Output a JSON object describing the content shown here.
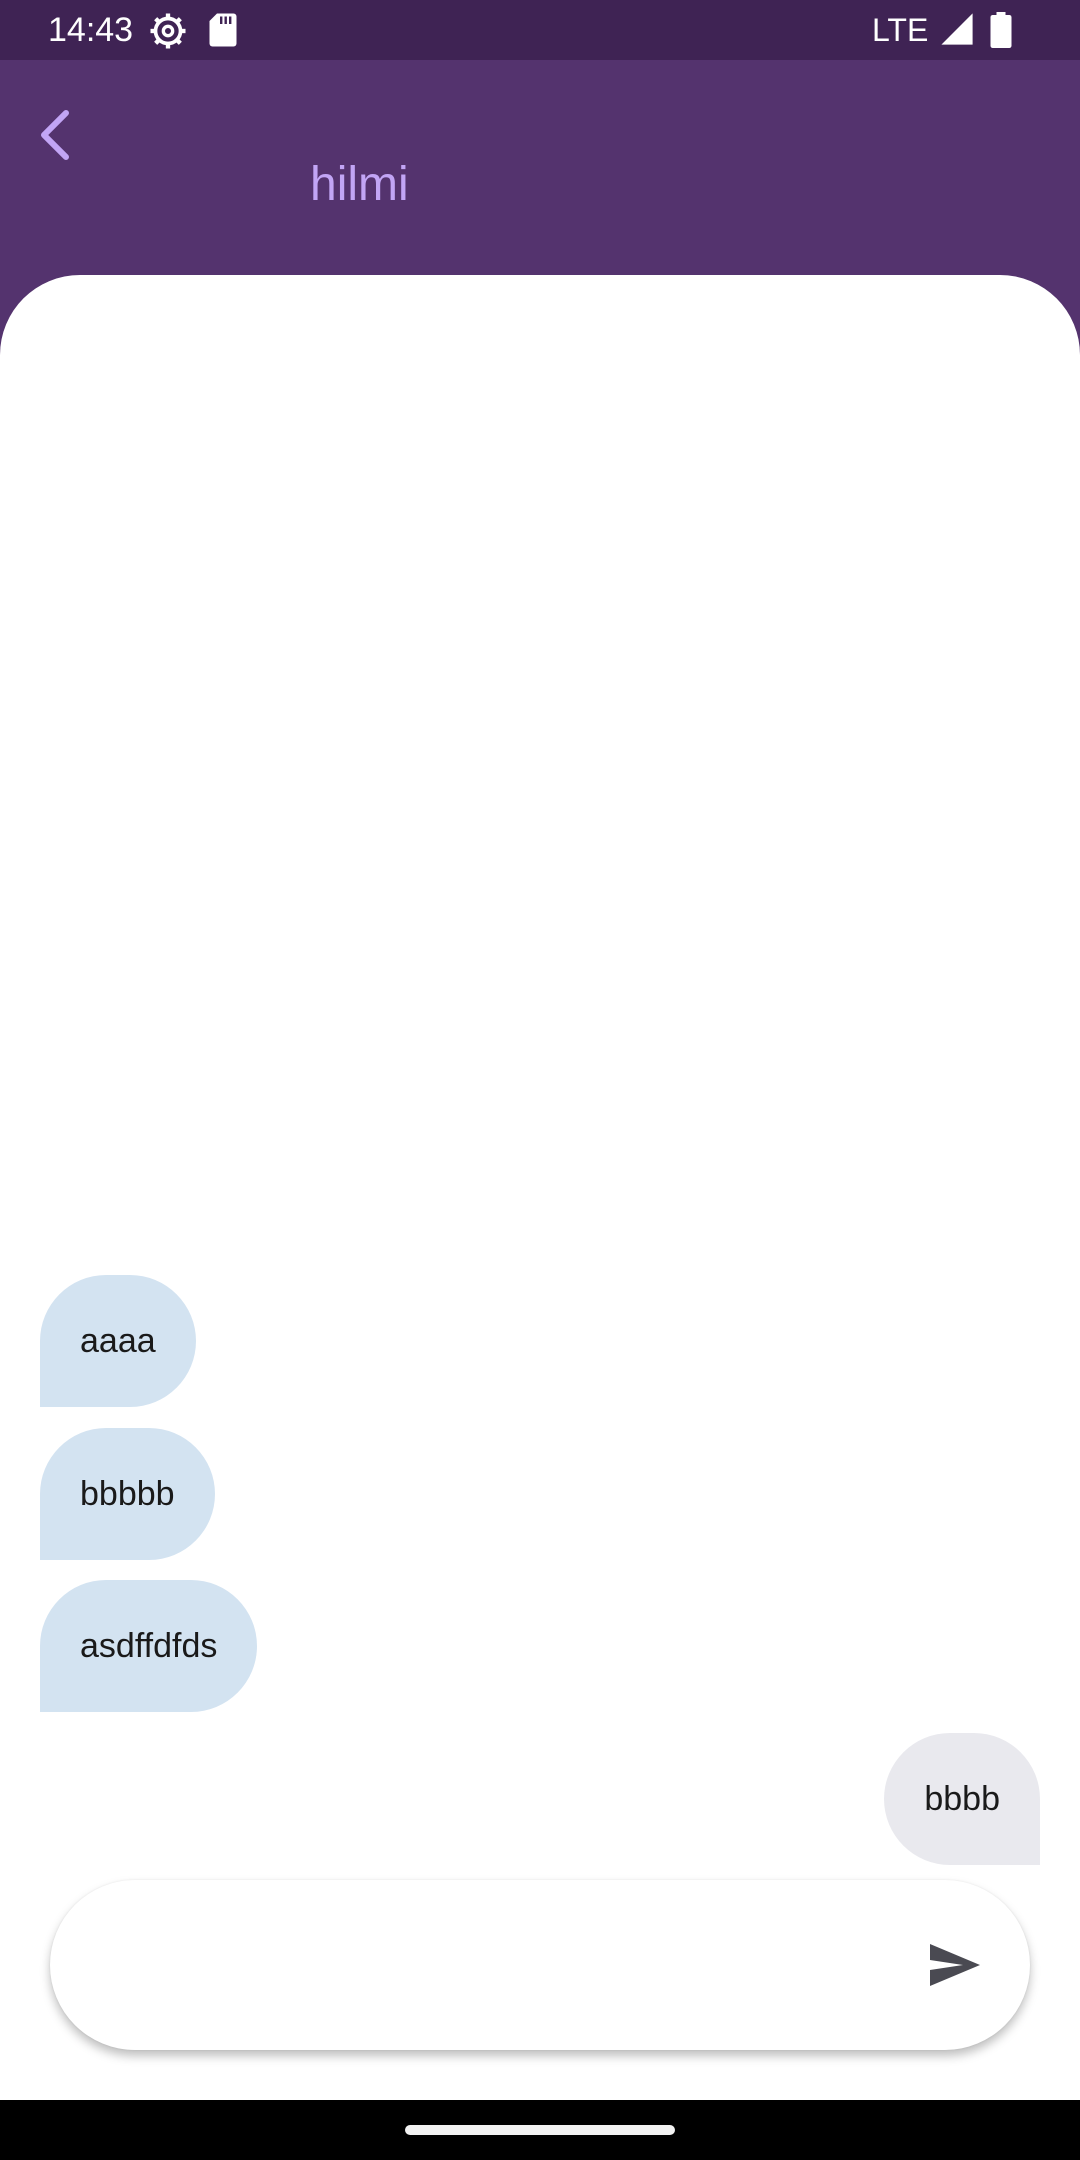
{
  "status_bar": {
    "time": "14:43",
    "network": "LTE",
    "icons": [
      "settings-gear-icon",
      "sd-card-icon",
      "signal-icon",
      "battery-icon"
    ]
  },
  "header": {
    "title": "hilmi",
    "back_icon": "chevron-left-icon"
  },
  "messages": [
    {
      "text": "aaaa",
      "direction": "received"
    },
    {
      "text": "bbbbb",
      "direction": "received"
    },
    {
      "text": "asdffdfds",
      "direction": "received"
    },
    {
      "text": "bbbb",
      "direction": "sent"
    }
  ],
  "composer": {
    "value": "",
    "placeholder": "",
    "send_icon": "send-icon"
  },
  "colors": {
    "status_bar": "#3F2354",
    "header": "#54336E",
    "title": "#C2A5F5",
    "received_bubble": "#D3E3F1",
    "sent_bubble": "#E9E9EE"
  }
}
